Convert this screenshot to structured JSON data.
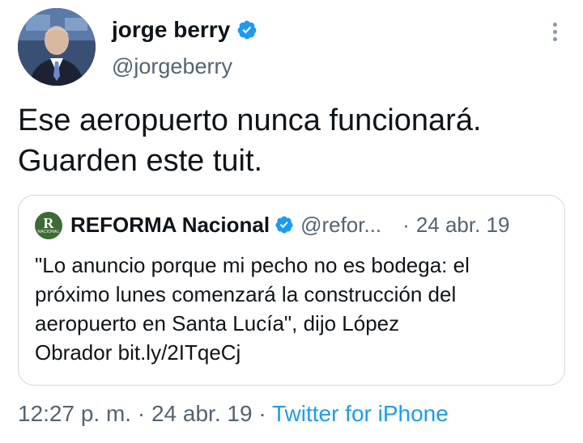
{
  "author": {
    "display_name": "jorge berry",
    "handle": "@jorgeberry",
    "verified": true
  },
  "tweet": {
    "lines": [
      "Ese aeropuerto nunca funcionará.",
      "Guarden este tuit."
    ]
  },
  "quoted_tweet": {
    "avatar_letter": "R",
    "avatar_subtext": "NACIONAL",
    "name": "REFORMA Nacional",
    "handle": "@refor...",
    "separator": "·",
    "date": "24 abr. 19",
    "text_lines": [
      "\"Lo anuncio porque mi pecho no es bodega: el",
      "próximo lunes comenzará la construcción del",
      "aeropuerto en Santa Lucía\", dijo López",
      "Obrador  bit.ly/2ITqeCj"
    ]
  },
  "footer": {
    "time": "12:27 p. m.",
    "sep1": "·",
    "date": "24 abr. 19",
    "sep2": "·",
    "app": "Twitter for iPhone"
  },
  "icons": {
    "verified": "verified-badge-icon",
    "more": "more-options-icon"
  },
  "colors": {
    "verified_blue": "#1d9bf0",
    "secondary_text": "#536471",
    "primary_text": "#0f1419",
    "border": "#cfd9de",
    "link": "#1d9bf0",
    "reforma_green": "#3d6b34"
  }
}
